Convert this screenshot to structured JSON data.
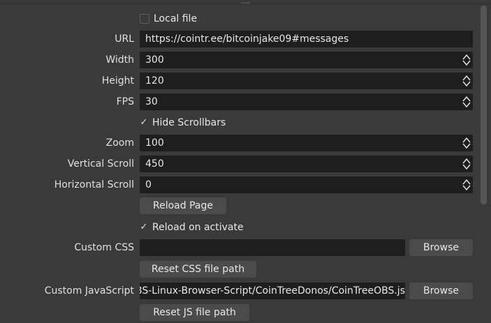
{
  "local_file": {
    "label": "Local file",
    "checked": false
  },
  "url": {
    "label": "URL",
    "value": "https://cointr.ee/bitcoinjake09#messages"
  },
  "width": {
    "label": "Width",
    "value": "300"
  },
  "height": {
    "label": "Height",
    "value": "120"
  },
  "fps": {
    "label": "FPS",
    "value": "30"
  },
  "hide_scrollbars": {
    "label": "Hide Scrollbars",
    "checked": true
  },
  "zoom": {
    "label": "Zoom",
    "value": "100"
  },
  "vertical_scroll": {
    "label": "Vertical Scroll",
    "value": "450"
  },
  "horizontal_scroll": {
    "label": "Horizontal Scroll",
    "value": "0"
  },
  "reload_page": {
    "label": "Reload Page"
  },
  "reload_on_activate": {
    "label": "Reload on activate",
    "checked": true
  },
  "custom_css": {
    "label": "Custom CSS",
    "value": "",
    "browse_label": "Browse",
    "reset_label": "Reset CSS file path"
  },
  "custom_js": {
    "label": "Custom JavaScript",
    "value": "OBS-Linux-Browser-Script/CoinTreeDonos/CoinTreeOBS.js",
    "browse_label": "Browse",
    "reset_label": "Reset JS file path"
  },
  "icons": {
    "check": "✓",
    "spin_up": "chevron-up-icon",
    "spin_down": "chevron-down-icon"
  },
  "colors": {
    "background": "#3a3a3a",
    "field": "#1e1e1e",
    "button": "#4b4b4b",
    "text": "#e8e8e8"
  }
}
